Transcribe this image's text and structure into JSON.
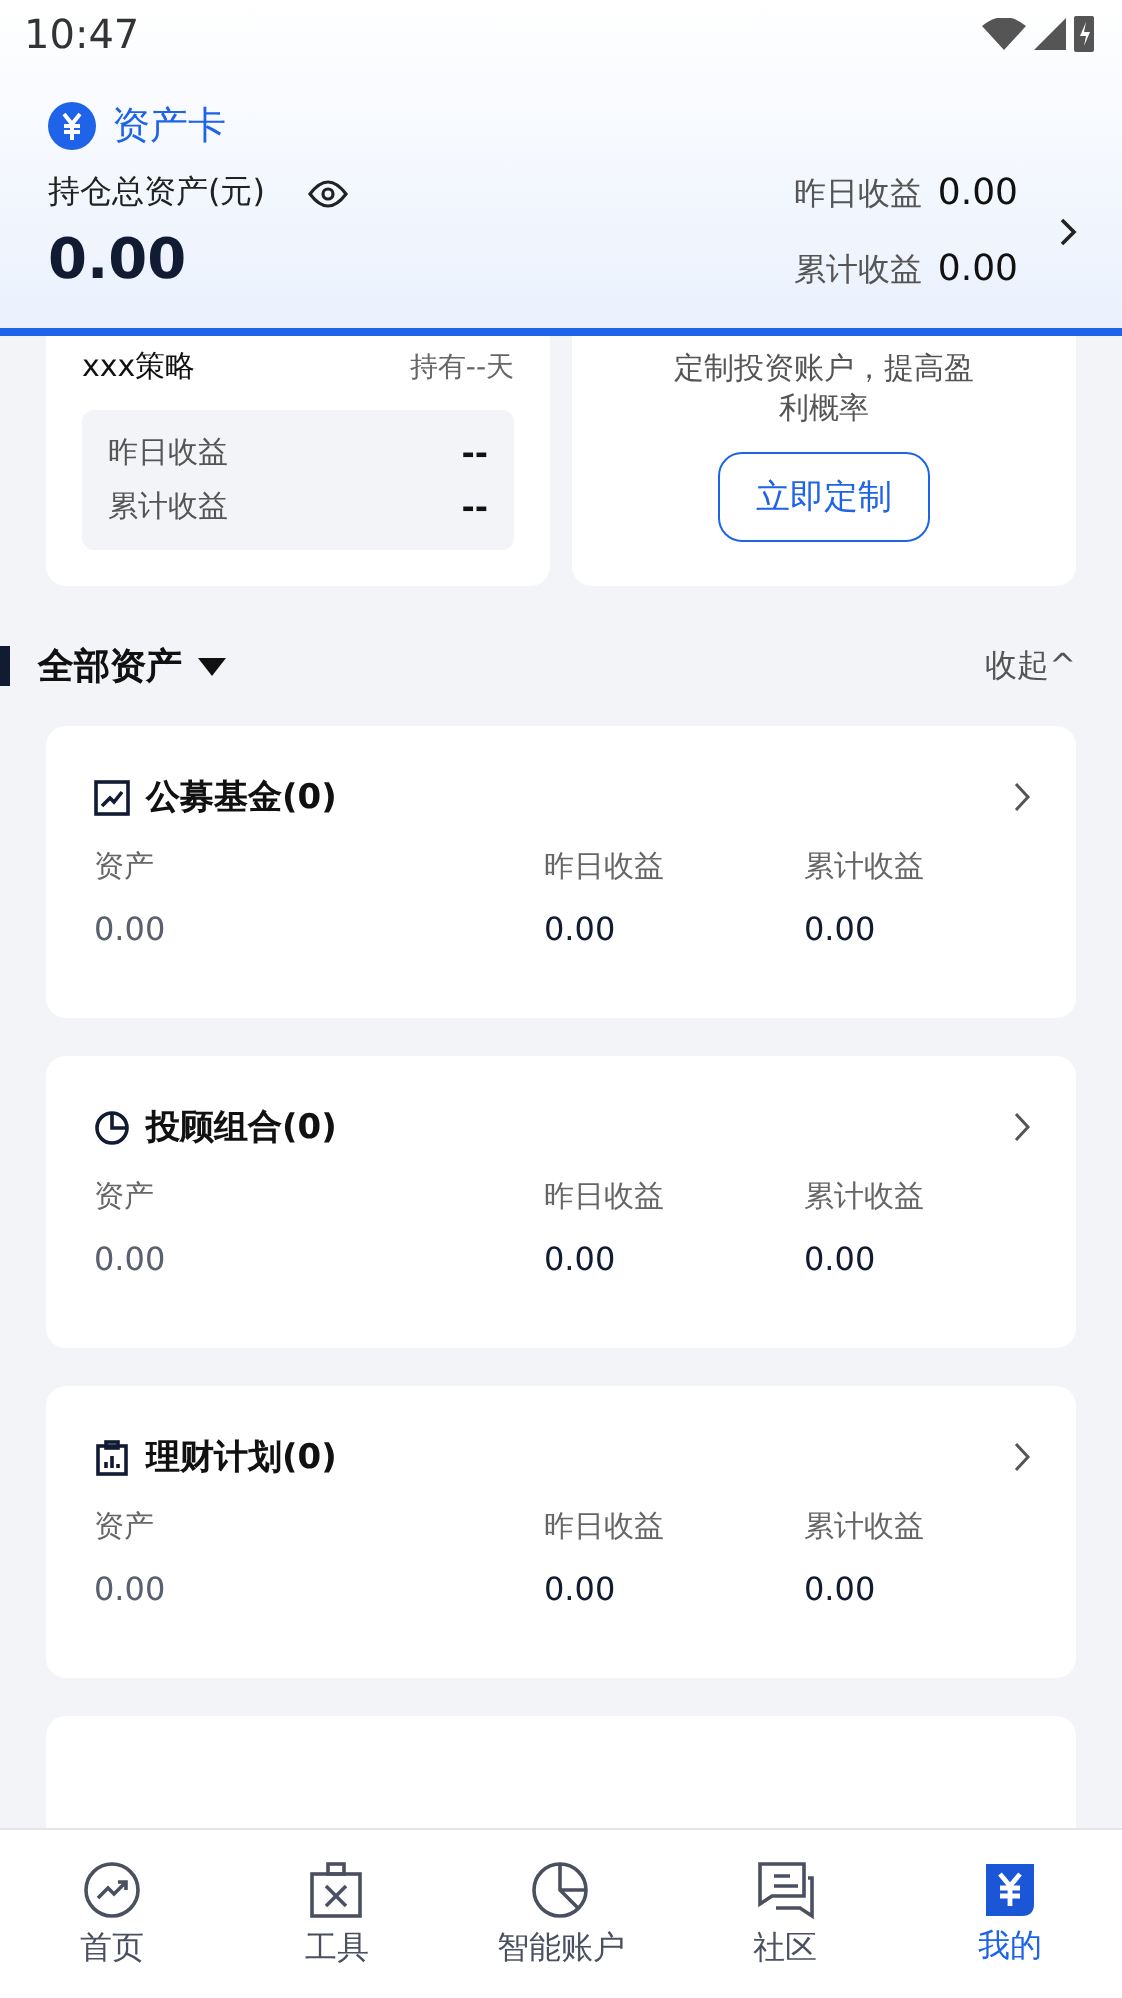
{
  "status_bar": {
    "time": "10:47"
  },
  "header": {
    "title": "资产卡",
    "total_label": "持仓总资产(元)",
    "total_value": "0.00",
    "stats": [
      {
        "label": "昨日收益",
        "value": "0.00"
      },
      {
        "label": "累计收益",
        "value": "0.00"
      }
    ]
  },
  "strategy_card": {
    "name": "xxx策略",
    "holding": "持有--天",
    "rows": [
      {
        "label": "昨日收益",
        "value": "--"
      },
      {
        "label": "累计收益",
        "value": "--"
      }
    ]
  },
  "promo_card": {
    "text": "定制投资账户，提高盈利概率",
    "button": "立即定制"
  },
  "section": {
    "title": "全部资产",
    "toggle": "收起^"
  },
  "asset_cards": [
    {
      "kind": "trend",
      "title": "公募基金(0)",
      "columns": [
        {
          "label": "资产",
          "value": "0.00"
        },
        {
          "label": "昨日收益",
          "value": "0.00"
        },
        {
          "label": "累计收益",
          "value": "0.00"
        }
      ]
    },
    {
      "kind": "pie",
      "title": "投顾组合(0)",
      "columns": [
        {
          "label": "资产",
          "value": "0.00"
        },
        {
          "label": "昨日收益",
          "value": "0.00"
        },
        {
          "label": "累计收益",
          "value": "0.00"
        }
      ]
    },
    {
      "kind": "clipboard",
      "title": "理财计划(0)",
      "columns": [
        {
          "label": "资产",
          "value": "0.00"
        },
        {
          "label": "昨日收益",
          "value": "0.00"
        },
        {
          "label": "累计收益",
          "value": "0.00"
        }
      ]
    }
  ],
  "tab_bar": [
    {
      "kind": "home",
      "label": "首页",
      "selected": false
    },
    {
      "kind": "tools",
      "label": "工具",
      "selected": false
    },
    {
      "kind": "pie",
      "label": "智能账户",
      "selected": false
    },
    {
      "kind": "chat",
      "label": "社区",
      "selected": false
    },
    {
      "kind": "mine",
      "label": "我的",
      "selected": true
    }
  ]
}
